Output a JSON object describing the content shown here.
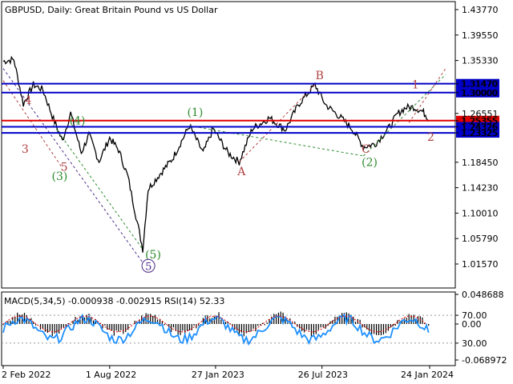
{
  "title": "GBPUSD, Daily:  Great Britain Pound vs US Dollar",
  "colors": {
    "candle": "#000000",
    "resistance": "#0000c8",
    "current": "#e00000",
    "macd_bar": "#000000",
    "signal": "#e00000",
    "rsi": "#1e90ff",
    "wave_red": "#b04040",
    "wave_green": "#2e8b2e",
    "wave_purple": "#4b2a88"
  },
  "chart_data": [
    {
      "type": "line",
      "name": "price",
      "y_ticks": [
        "1.43770",
        "1.39550",
        "1.35330",
        "1.31470",
        "1.30000",
        "1.26551",
        "1.25355",
        "1.24326",
        "1.23325",
        "1.18450",
        "1.14230",
        "1.10010",
        "1.05790",
        "1.01570"
      ],
      "x_ticks": [
        "2 Feb 2022",
        "1 Aug 2022",
        "27 Jan 2023",
        "26 Jul 2023",
        "24 Jan 2024"
      ],
      "levels": [
        {
          "name": "resistance-upper",
          "value": 1.3147,
          "label": "1.31470"
        },
        {
          "name": "resistance-lower",
          "value": 1.3,
          "label": "1.30000"
        },
        {
          "name": "current-price",
          "value": 1.25355,
          "label": "1.25355"
        },
        {
          "name": "support-upper",
          "value": 1.24326,
          "label": "1.24326"
        },
        {
          "name": "support-lower",
          "value": 1.23325,
          "label": "1.23325"
        }
      ],
      "ylim": [
        1.0157,
        1.4377
      ],
      "wave_labels": [
        {
          "text": "4",
          "color": "red",
          "x": "2022-03-10",
          "y": 1.281
        },
        {
          "text": "3",
          "color": "red",
          "x": "2022-03-05",
          "y": 1.2
        },
        {
          "text": "5",
          "color": "red",
          "x": "2022-05-10",
          "y": 1.17
        },
        {
          "text": "(4)",
          "color": "green",
          "x": "2022-05-25",
          "y": 1.247
        },
        {
          "text": "(3)",
          "color": "green",
          "x": "2022-04-25",
          "y": 1.155
        },
        {
          "text": "(5)",
          "color": "green",
          "x": "2022-09-30",
          "y": 1.025
        },
        {
          "text": "5",
          "color": "purple",
          "x": "2022-09-30",
          "y": 1.006
        },
        {
          "text": "(1)",
          "color": "green",
          "x": "2022-12-10",
          "y": 1.261
        },
        {
          "text": "A",
          "color": "red",
          "x": "2023-03-05",
          "y": 1.163
        },
        {
          "text": "B",
          "color": "red",
          "x": "2023-07-15",
          "y": 1.322
        },
        {
          "text": "C",
          "color": "red",
          "x": "2023-10-01",
          "y": 1.2
        },
        {
          "text": "(2)",
          "color": "green",
          "x": "2023-10-01",
          "y": 1.178
        },
        {
          "text": "1",
          "color": "red",
          "x": "2023-12-25",
          "y": 1.307
        },
        {
          "text": "2",
          "color": "red",
          "x": "2024-01-20",
          "y": 1.22
        }
      ]
    },
    {
      "type": "line",
      "name": "indicators",
      "label": "MACD(5,34,5) -0.000938 -0.002915 RSI(14) 52.33",
      "y_ticks_left_macd": [
        "0.048688",
        "0.00",
        "-0.068972"
      ],
      "y_ticks_rsi": [
        "70.00",
        "30.00"
      ]
    }
  ]
}
